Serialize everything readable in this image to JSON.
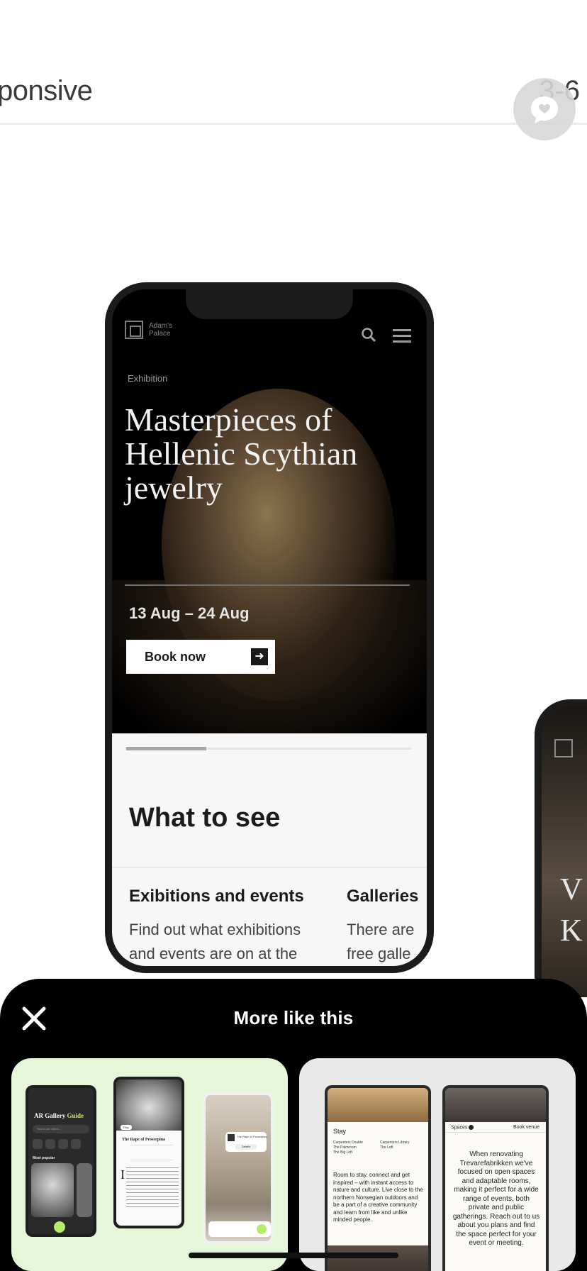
{
  "header": {
    "title": "ponsive",
    "count": "3-6"
  },
  "fab": {
    "icon": "chat-heart-icon"
  },
  "mockup": {
    "brand": "Adam's Palace",
    "eyebrow": "Exhibition",
    "title": "Masterpieces of\nHellenic  Scythian\njewelry",
    "dates_start": "13 Aug",
    "dates_sep": " – ",
    "dates_end": "24 Aug",
    "book_label": "Book now",
    "progress": 0.28,
    "section_title": "What to see",
    "cards": [
      {
        "title": "Exibitions and events",
        "body": "Find out what exhibitions\nand events are on at the"
      },
      {
        "title": "Galleries",
        "body": "There are\nfree galle"
      }
    ]
  },
  "peek": {
    "letters": [
      "V",
      "K"
    ]
  },
  "sheet": {
    "title": "More like this",
    "close_icon": "close-icon",
    "tile_a": {
      "app_title_a": "AR Gallery",
      "app_title_b": "Guide",
      "search_placeholder": "Search art object...",
      "most_popular": "Most popular",
      "artwork_title": "The Rape of Proserpina",
      "art_small_title": "The Rape of Proserpina",
      "details_label": "Details",
      "play_label": "Play"
    },
    "tile_b": {
      "stay_heading": "Stay",
      "rooms_left": [
        "Carpenters Double",
        "The Palmroom",
        "The Big Loft"
      ],
      "rooms_right": [
        "Carpenters Library",
        "The Loft"
      ],
      "stay_body": "Room to stay, connect and get inspired – with instant access to nature and culture. Live close to the northern Norwegian outdoors and be a part of a creative community and learn from like and unlike minded people.",
      "spaces_label": "Spaces",
      "book_venue": "Book venue",
      "spaces_body": "When renovating Trevarefabrikken we've focused on open spaces and adaptable rooms, making it perfect for a wide range of events, both private and public gatherings. Reach out to us about you plans and find the space perfect for your event or meeting."
    }
  }
}
